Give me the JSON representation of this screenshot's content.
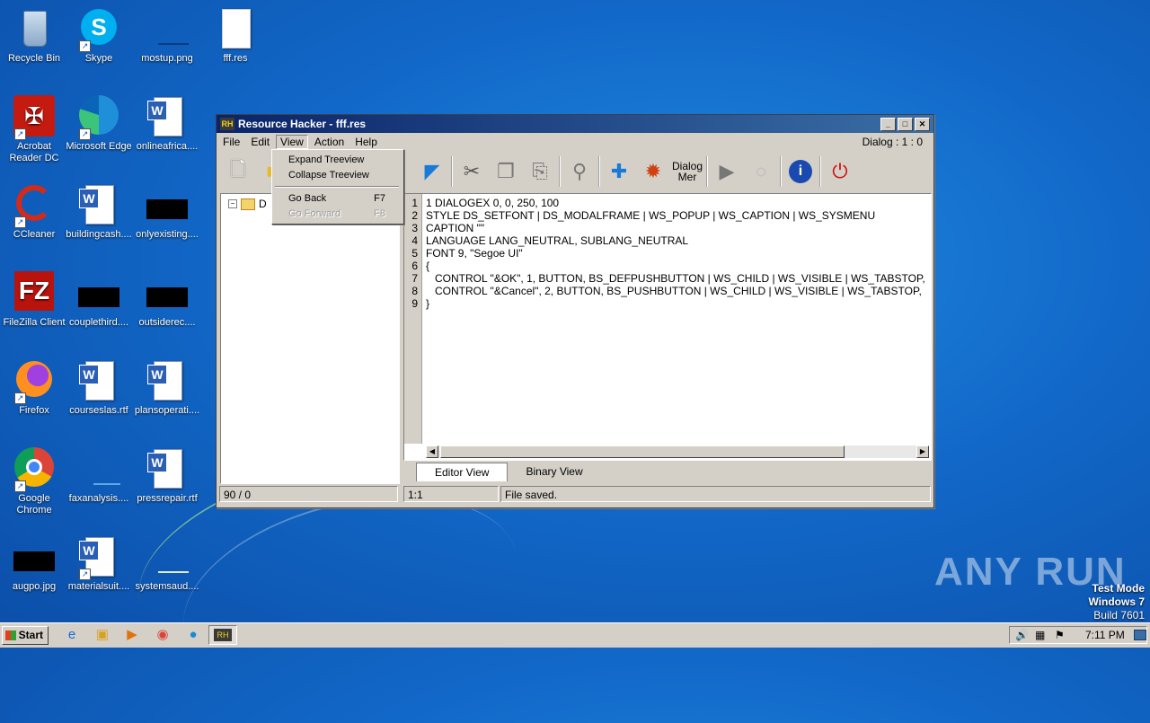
{
  "desktop": {
    "icons": [
      {
        "label": "Recycle Bin",
        "icon": "recycle-bin-icon"
      },
      {
        "label": "Skype",
        "icon": "skype-icon"
      },
      {
        "label": "mostup.png",
        "icon": "image-file-icon"
      },
      {
        "label": "fff.res",
        "icon": "file-icon"
      },
      {
        "label": "Acrobat Reader DC",
        "icon": "acrobat-icon"
      },
      {
        "label": "Microsoft Edge",
        "icon": "edge-icon"
      },
      {
        "label": "onlineafrica....",
        "icon": "word-doc-icon"
      },
      {
        "label": "CCleaner",
        "icon": "ccleaner-icon"
      },
      {
        "label": "buildingcash....",
        "icon": "word-doc-icon"
      },
      {
        "label": "onlyexisting....",
        "icon": "black-file-icon"
      },
      {
        "label": "FileZilla Client",
        "icon": "filezilla-icon"
      },
      {
        "label": "couplethird....",
        "icon": "black-file-icon"
      },
      {
        "label": "outsiderec....",
        "icon": "black-file-icon"
      },
      {
        "label": "Firefox",
        "icon": "firefox-icon"
      },
      {
        "label": "courseslas.rtf",
        "icon": "word-doc-icon"
      },
      {
        "label": "plansoperati....",
        "icon": "word-doc-icon"
      },
      {
        "label": "Google Chrome",
        "icon": "chrome-icon"
      },
      {
        "label": "faxanalysis....",
        "icon": "blank-file-icon"
      },
      {
        "label": "pressrepair.rtf",
        "icon": "word-doc-icon"
      },
      {
        "label": "augpo.jpg",
        "icon": "black-file-icon"
      },
      {
        "label": "materialsuit....",
        "icon": "word-doc-icon"
      },
      {
        "label": "systemsaud....",
        "icon": "blank-file-icon"
      }
    ]
  },
  "window": {
    "title": "Resource Hacker - fff.res",
    "app_badge": "RH",
    "menus": [
      "File",
      "Edit",
      "View",
      "Action",
      "Help"
    ],
    "dialog_status": "Dialog : 1 : 0",
    "toolbar": [
      "new-file-icon",
      "open-folder-icon",
      "arrow-icon",
      "cut-icon",
      "copy-icon",
      "paste-icon",
      "search-icon",
      "add-resource-icon",
      "image-resource-icon",
      "dialog-merge-icon",
      "play-icon",
      "lightbulb-icon",
      "info-icon",
      "power-icon"
    ],
    "toolbar_dialog_label": "Dialog",
    "toolbar_dialog_sub": "Mer",
    "tree_node": "D",
    "code_lines": [
      "1 DIALOGEX 0, 0, 250, 100",
      "STYLE DS_SETFONT | DS_MODALFRAME | WS_POPUP | WS_CAPTION | WS_SYSMENU",
      "CAPTION \"\"",
      "LANGUAGE LANG_NEUTRAL, SUBLANG_NEUTRAL",
      "FONT 9, \"Segoe UI\"",
      "{",
      "   CONTROL \"&OK\", 1, BUTTON, BS_DEFPUSHBUTTON | WS_CHILD | WS_VISIBLE | WS_TABSTOP,",
      "   CONTROL \"&Cancel\", 2, BUTTON, BS_PUSHBUTTON | WS_CHILD | WS_VISIBLE | WS_TABSTOP,",
      "}"
    ],
    "line_numbers": [
      "1",
      "2",
      "3",
      "4",
      "5",
      "6",
      "7",
      "8",
      "9"
    ],
    "tabs": [
      "Editor View",
      "Binary View"
    ],
    "status": {
      "left": "90 / 0",
      "position": "1:1",
      "message": "File saved."
    }
  },
  "view_menu": {
    "items": [
      {
        "label": "Expand Treeview",
        "key": ""
      },
      {
        "label": "Collapse Treeview",
        "key": ""
      },
      {
        "label": "Go Back",
        "key": "F7"
      },
      {
        "label": "Go Forward",
        "key": "F8"
      }
    ]
  },
  "taskbar": {
    "start": "Start",
    "clock": "7:11 PM",
    "active_app": "RH"
  },
  "watermark": "ANY RUN",
  "testmode": {
    "line1": "Test Mode",
    "line2": "Windows 7",
    "line3": "Build 7601"
  }
}
